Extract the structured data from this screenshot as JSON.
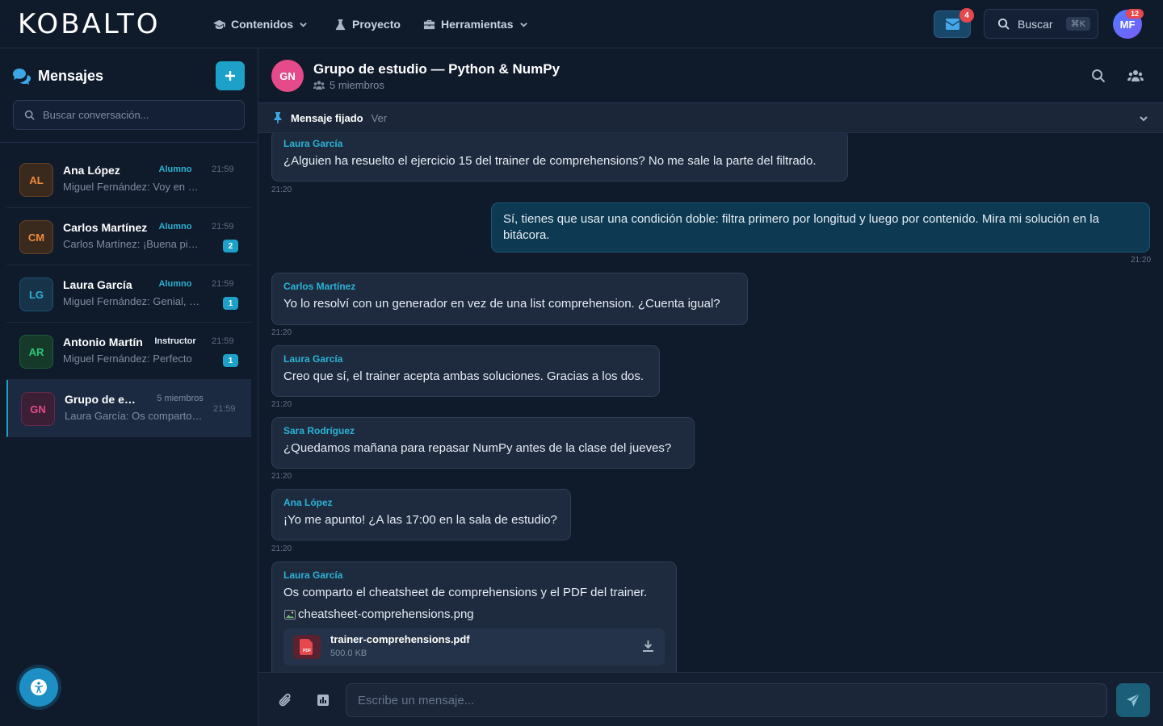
{
  "app": {
    "logo": "KOBALTO"
  },
  "topnav": {
    "items": [
      {
        "label": "Contenidos",
        "has_menu": true,
        "icon": "graduation-cap-icon"
      },
      {
        "label": "Proyecto",
        "has_menu": false,
        "icon": "flask-icon"
      },
      {
        "label": "Herramientas",
        "has_menu": true,
        "icon": "toolbox-icon"
      }
    ],
    "mail_badge": "4",
    "search_label": "Buscar",
    "search_shortcut": "⌘K",
    "user_initials": "MF",
    "user_badge": "12"
  },
  "sidebar": {
    "title": "Mensajes",
    "search_placeholder": "Buscar conversación...",
    "conversations": [
      {
        "initials": "AL",
        "name": "Ana López",
        "role": "Alumno",
        "time": "21:59",
        "preview": "Miguel Fernández: Voy en camino",
        "unread": "",
        "av_bg": "#3a2a1e",
        "av_fg": "#f08a3c",
        "role_color": "#2ab3d6"
      },
      {
        "initials": "CM",
        "name": "Carlos Martínez",
        "role": "Alumno",
        "time": "21:59",
        "preview": "Carlos Martínez: ¡Buena pista!",
        "unread": "2",
        "av_bg": "#3a2a1e",
        "av_fg": "#f08a3c",
        "role_color": "#2ab3d6"
      },
      {
        "initials": "LG",
        "name": "Laura García",
        "role": "Alumno",
        "time": "21:59",
        "preview": "Miguel Fernández: Genial, gracias",
        "unread": "1",
        "av_bg": "#17334a",
        "av_fg": "#2ab3d6",
        "role_color": "#2ab3d6"
      },
      {
        "initials": "AR",
        "name": "Antonio Martín",
        "role": "Instructor",
        "time": "21:59",
        "preview": "Miguel Fernández: Perfecto",
        "unread": "1",
        "av_bg": "#163a2a",
        "av_fg": "#2bc77a",
        "role_color": "#e6edf5"
      },
      {
        "initials": "GN",
        "name": "Grupo de estudio — Python & NumPy",
        "role": "5 miembros",
        "time": "21:59",
        "preview": "Laura García: Os comparto el cheatsheet",
        "unread": "",
        "av_bg": "#3a1f35",
        "av_fg": "#e54a8a",
        "role_color": "#7f8ca0"
      }
    ]
  },
  "chat": {
    "group_initials": "GN",
    "group_name": "Grupo de estudio — Python & NumPy",
    "members": "5 miembros",
    "pinned_label": "Mensaje fijado",
    "pinned_view": "Ver",
    "messages": [
      {
        "sender": "Laura García",
        "text": "¿Alguien ha resuelto el ejercicio 15 del trainer de comprehensions? No me sale la parte del filtrado.",
        "time": "21:20"
      },
      {
        "sender": "",
        "text": "Sí, tienes que usar una condición doble: filtra primero por longitud y luego por contenido. Mira mi solución en la bitácora.",
        "time": "21:20"
      },
      {
        "sender": "Carlos Martínez",
        "text": "Yo lo resolví con un generador en vez de una list comprehension. ¿Cuenta igual?",
        "time": "21:20"
      },
      {
        "sender": "Laura García",
        "text": "Creo que sí, el trainer acepta ambas soluciones. Gracias a los dos.",
        "time": "21:20"
      },
      {
        "sender": "Sara Rodríguez",
        "text": "¿Quedamos mañana para repasar NumPy antes de la clase del jueves?",
        "time": "21:20"
      },
      {
        "sender": "Ana López",
        "text": "¡Yo me apunto! ¿A las 17:00 en la sala de estudio?",
        "time": "21:20"
      },
      {
        "sender": "Laura García",
        "text": "Os comparto el cheatsheet de comprehensions y el PDF del trainer.",
        "time": ""
      }
    ],
    "attachment_image": "cheatsheet-comprehensions.png",
    "attachment_file": {
      "name": "trainer-comprehensions.pdf",
      "size": "500.0 KB",
      "badge": "PDF"
    },
    "composer_placeholder": "Escribe un mensaje..."
  },
  "colors": {
    "accent": "#1ea1c8",
    "background": "#0f1a2b",
    "incoming": "#1e2b3e",
    "outgoing": "#0d3a52",
    "badge_red": "#e5484d"
  }
}
